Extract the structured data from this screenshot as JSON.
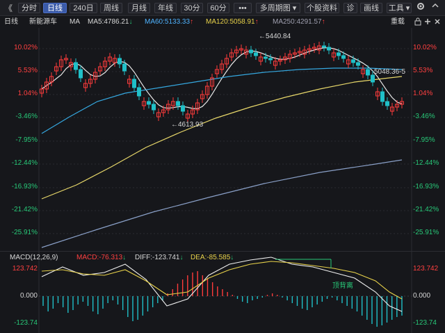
{
  "toolbar": {
    "buttons": [
      {
        "label": "分时",
        "active": false
      },
      {
        "label": "日线",
        "active": true
      },
      {
        "label": "240日",
        "active": false
      },
      {
        "label": "周线",
        "active": false
      },
      {
        "label": "月线",
        "active": false
      },
      {
        "label": "年线",
        "active": false
      },
      {
        "label": "30分",
        "active": false
      },
      {
        "label": "60分",
        "active": false
      },
      {
        "label": "•••",
        "active": false
      },
      {
        "label": "多周期图 ▾",
        "active": false
      },
      {
        "label": "个股资料",
        "active": false
      },
      {
        "label": "诊",
        "active": false
      },
      {
        "label": "画线",
        "active": false
      },
      {
        "label": "工具 ▾",
        "active": false
      }
    ],
    "nav_left": "《",
    "gear_icon": "gear-icon",
    "restore": "重载"
  },
  "info": {
    "period": "日线",
    "name": "新能源车",
    "ma_label": "MA",
    "ma5": "MA5:4786.21",
    "ma60": "MA60:5133.33",
    "ma120": "MA120:5058.91",
    "ma250": "MA250:4291.57",
    "restore": "重载"
  },
  "price_axis": [
    "10.02%",
    "5.53%",
    "1.04%",
    "-3.46%",
    "-7.95%",
    "-12.44%",
    "-16.93%",
    "-21.42%",
    "-25.91%"
  ],
  "annotations": {
    "high": "5440.84",
    "low": "4613.93",
    "last": "5048.36-5"
  },
  "macd": {
    "title": "MACD(12,26,9)",
    "macd": "MACD:-76.313",
    "diff": "DIFF:-123.741",
    "dea": "DEA:-85.585",
    "axis_top": "123.742",
    "axis_mid": "0.000",
    "axis_bot": "-123.74",
    "divergence": "顶背离"
  },
  "chart_data": {
    "type": "candlestick",
    "title": "新能源车",
    "y_axis_ticks_pct": [
      10.02,
      5.53,
      1.04,
      -3.46,
      -7.95,
      -12.44,
      -16.93,
      -21.42,
      -25.91
    ],
    "high_marker": 5440.84,
    "low_marker": 4613.93,
    "last_marker": 5048.36,
    "moving_averages": [
      {
        "name": "MA5",
        "value": 4786.21,
        "color": "#e8e8e8"
      },
      {
        "name": "MA60",
        "value": 5133.33,
        "color": "#35a8e0"
      },
      {
        "name": "MA120",
        "value": 5058.91,
        "color": "#e8d86a"
      },
      {
        "name": "MA250",
        "value": 4291.57,
        "color": "#8aa0c8"
      }
    ],
    "indicator": {
      "name": "MACD(12,26,9)",
      "MACD": -76.313,
      "DIFF": -123.741,
      "DEA": -85.585,
      "range": [
        -123.74,
        123.742
      ]
    }
  },
  "colors": {
    "up": "#ff3b3b",
    "down": "#20c0c8",
    "ma5": "#e8e8e8",
    "ma60": "#35a8e0",
    "ma120": "#e8d86a",
    "ma250": "#8aa0c8",
    "diff": "#f0f0f0",
    "dea": "#e8d24a",
    "bg": "#16171b"
  }
}
